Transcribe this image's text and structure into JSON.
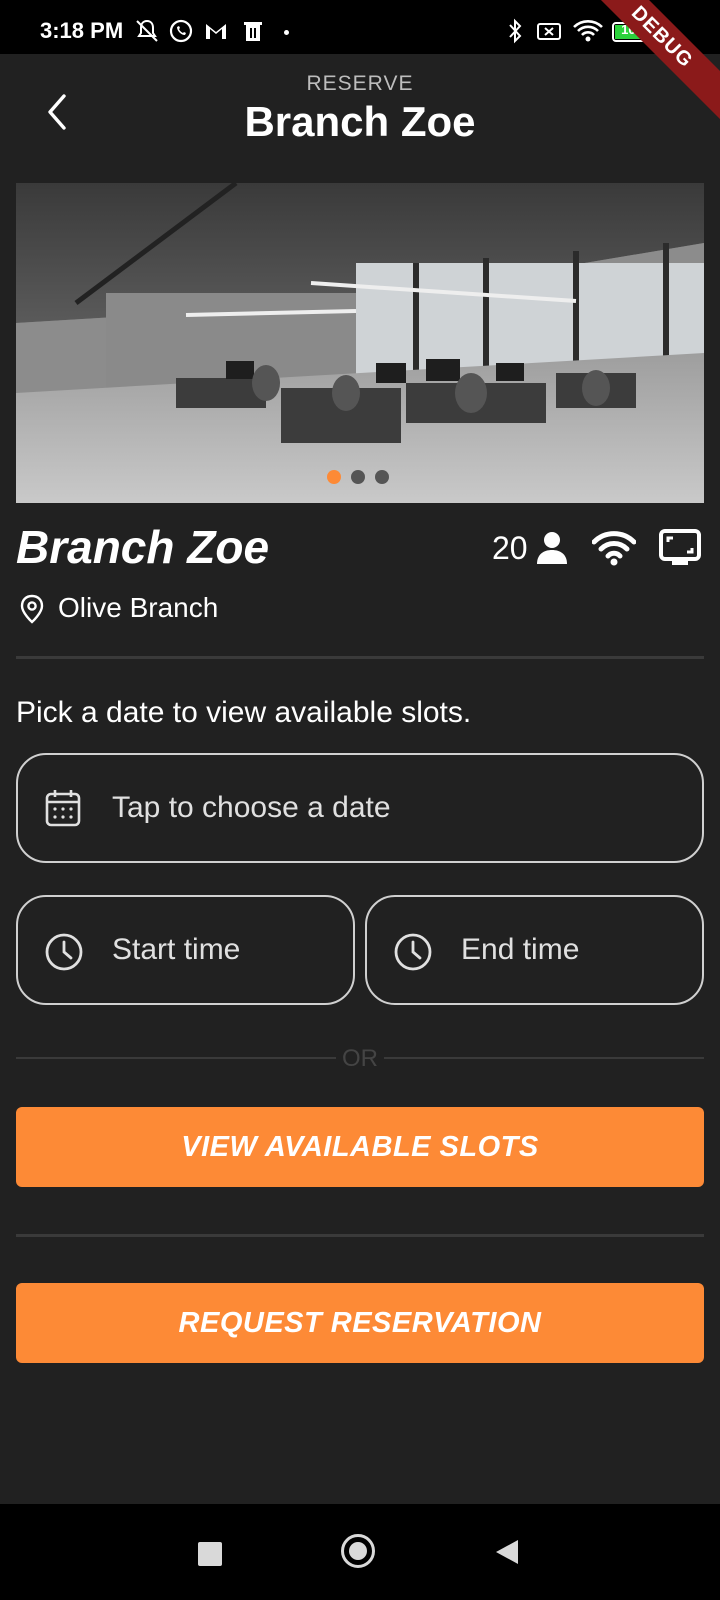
{
  "status_bar": {
    "time": "3:18 PM",
    "battery": "100",
    "debug_label": "DEBUG"
  },
  "header": {
    "eyebrow": "RESERVE",
    "title": "Branch Zoe"
  },
  "carousel": {
    "page_count": 3,
    "active_index": 0,
    "active_color": "#fd8a36"
  },
  "venue": {
    "name": "Branch Zoe",
    "capacity": "20",
    "location": "Olive Branch",
    "amenity_icons": [
      "person-icon",
      "wifi-icon",
      "tv-icon"
    ]
  },
  "booking": {
    "prompt": "Pick a date to view available slots.",
    "date_placeholder": "Tap to choose a date",
    "start_placeholder": "Start time",
    "end_placeholder": "End time",
    "or_label": "OR",
    "view_slots_label": "VIEW AVAILABLE SLOTS",
    "request_label": "REQUEST RESERVATION"
  },
  "colors": {
    "accent": "#fd8a36",
    "background": "#212121"
  }
}
